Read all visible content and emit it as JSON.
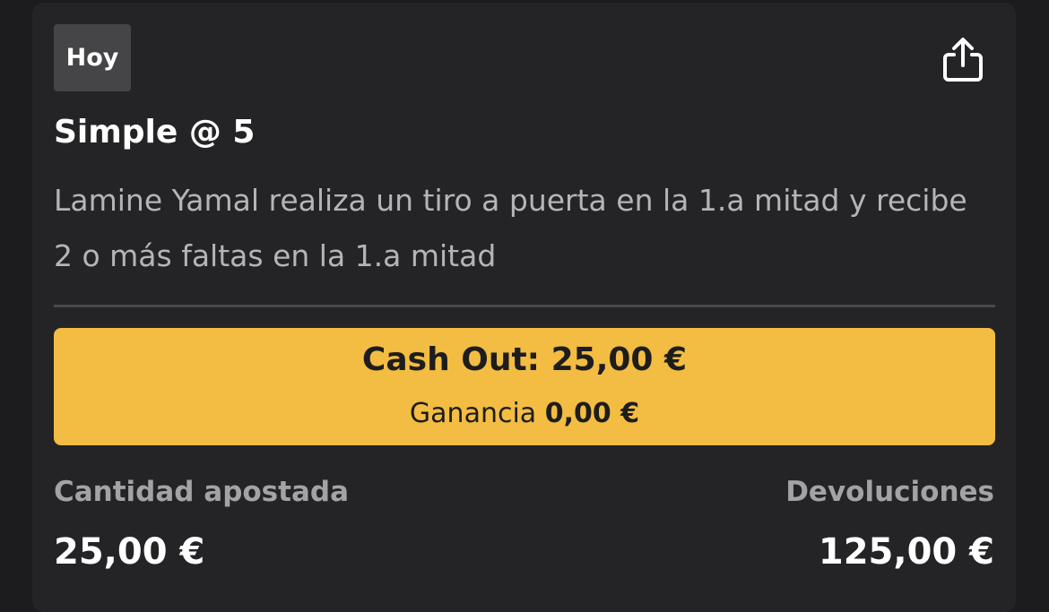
{
  "bet": {
    "badge": "Hoy",
    "title": "Simple @ 5",
    "description": "Lamine Yamal realiza un tiro a puerta en la 1.a mitad y recibe 2 o más faltas en la 1.a mitad",
    "share_icon": "share-icon"
  },
  "cashout": {
    "label": "Cash Out: 25,00 €",
    "profit_label": "Ganancia",
    "profit_value": "0,00 €",
    "color": "#f3bc42"
  },
  "stats": {
    "stake_label": "Cantidad apostada",
    "stake_value": "25,00 €",
    "returns_label": "Devoluciones",
    "returns_value": "125,00 €"
  }
}
